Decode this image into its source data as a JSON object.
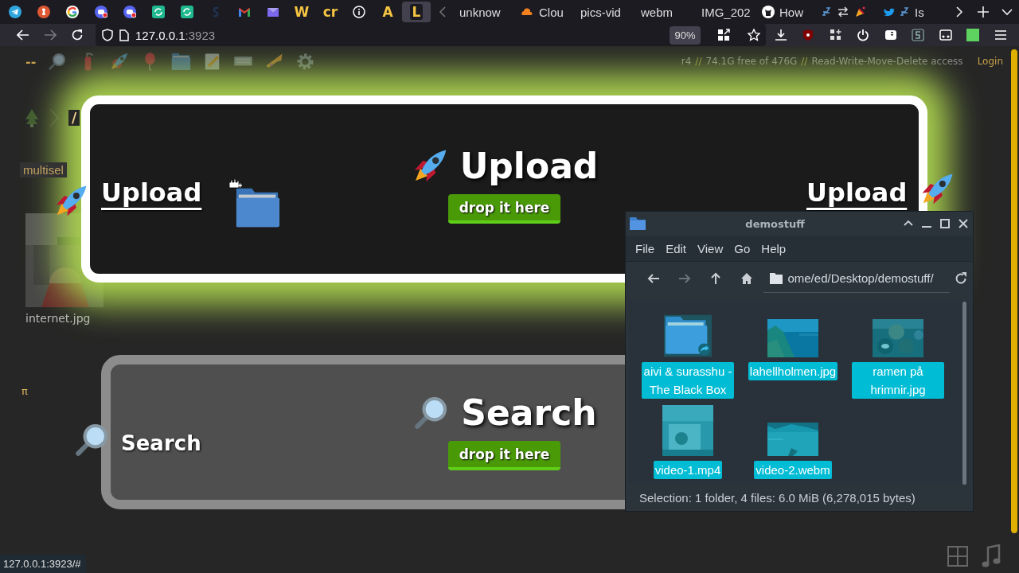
{
  "pinned_tabs": [
    {
      "kind": "icon",
      "selected": false
    },
    {
      "kind": "icon",
      "selected": false
    },
    {
      "kind": "icon",
      "selected": false
    },
    {
      "kind": "icon",
      "selected": false
    },
    {
      "kind": "icon",
      "selected": false
    },
    {
      "kind": "icon",
      "selected": false
    },
    {
      "kind": "icon",
      "selected": false
    },
    {
      "kind": "icon",
      "selected": false
    },
    {
      "kind": "icon",
      "selected": false
    },
    {
      "kind": "icon",
      "selected": false
    },
    {
      "kind": "letter",
      "label": "W",
      "selected": false
    },
    {
      "kind": "letter",
      "label": "cr",
      "selected": false
    },
    {
      "kind": "icon",
      "selected": false
    },
    {
      "kind": "letter",
      "label": "A",
      "selected": false
    },
    {
      "kind": "letter",
      "label": "L",
      "selected": true
    }
  ],
  "tabs": [
    {
      "kind": "text",
      "label": "unknow",
      "selected": false
    },
    {
      "kind": "text",
      "label": "Clou",
      "selected": false
    },
    {
      "kind": "text",
      "label": "pics-vid",
      "selected": false
    },
    {
      "kind": "text",
      "label": "webm",
      "selected": false
    },
    {
      "kind": "text",
      "label": "IMG_202",
      "selected": false
    },
    {
      "kind": "text",
      "label": "How",
      "selected": false
    },
    {
      "kind": "icon",
      "selected": false
    },
    {
      "kind": "text",
      "label": "Is",
      "selected": false
    }
  ],
  "address": {
    "host": "127.0.0.1",
    "port": ":3923"
  },
  "zoom": "90%",
  "page": {
    "menu_text": "--",
    "status": [
      {
        "kind": "text",
        "text": "r4"
      },
      {
        "kind": "sep",
        "text": "//"
      },
      {
        "kind": "text",
        "text": "74.1G free of 476G"
      },
      {
        "kind": "sep",
        "text": "//"
      },
      {
        "kind": "text",
        "text": "Read-Write-Move-Delete access"
      }
    ],
    "login": "Login",
    "breadcrumb": "/",
    "multiselect": "multisel",
    "thumbnail_name": "internet.jpg",
    "pi": "π"
  },
  "upload_zone": {
    "title": "Upload",
    "button": "drop it here",
    "side_labels": [
      "Upload",
      "Upload"
    ]
  },
  "search_zone": {
    "title": "Search",
    "button": "drop it here",
    "side_label": "Search"
  },
  "status_url": "127.0.0.1:3923/#",
  "file_manager": {
    "title": "demostuff",
    "menu": [
      "File",
      "Edit",
      "View",
      "Go",
      "Help"
    ],
    "path": "ome/ed/Desktop/demostuff/",
    "items": [
      {
        "name": "aivi & surasshu - The Black Box",
        "kind": "folder",
        "selected": true
      },
      {
        "name": "lahellholmen.jpg",
        "selected": true
      },
      {
        "name": "ramen på hrimnir.jpg",
        "selected": true
      },
      {
        "name": "video-1.mp4",
        "kind": "video",
        "selected": true
      },
      {
        "name": "video-2.webm",
        "kind": "video",
        "selected": true
      }
    ],
    "status": "Selection: 1 folder, 4 files: 6.0 MiB (6,278,015 bytes)"
  }
}
